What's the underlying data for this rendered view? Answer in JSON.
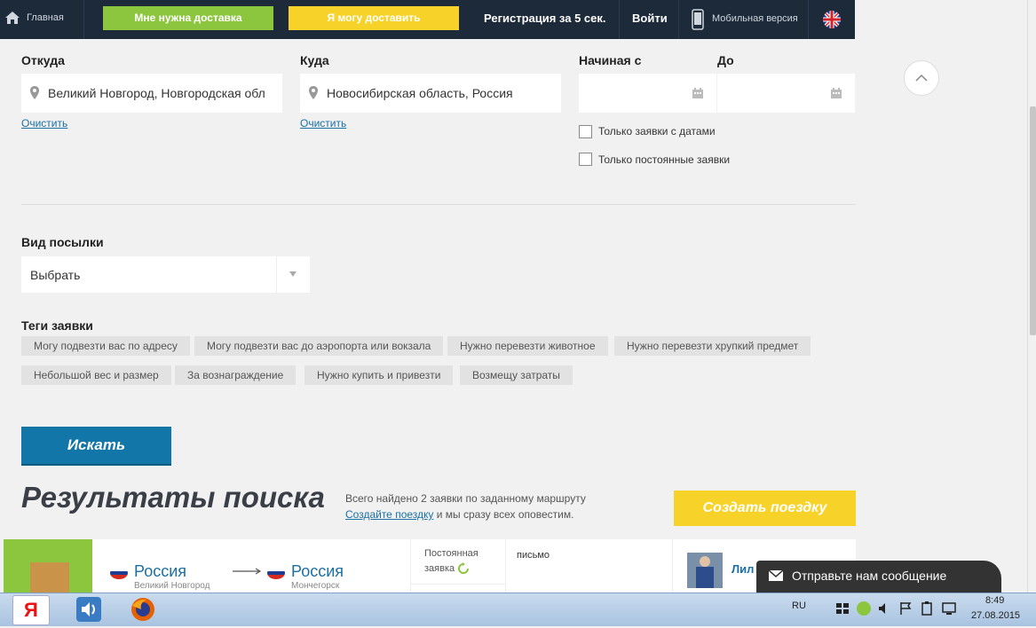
{
  "nav": {
    "home": "Главная",
    "need_delivery": "Мне нужна доставка",
    "can_deliver": "Я могу доставить",
    "register": "Регистрация за 5 сек.",
    "login": "Войти",
    "mobile": "Мобильная версия"
  },
  "form": {
    "from_label": "Откуда",
    "from_value": "Великий Новгород, Новгородская обл",
    "to_label": "Куда",
    "to_value": "Новосибирская область, Россия",
    "clear": "Очистить",
    "start_label": "Начиная с",
    "end_label": "До",
    "only_dates": "Только заявки с датами",
    "only_permanent": "Только постоянные заявки",
    "parcel_label": "Вид посылки",
    "parcel_value": "Выбрать",
    "tags_label": "Теги заявки",
    "tags": [
      "Могу подвезти вас по адресу",
      "Могу подвезти вас до аэропорта или вокзала",
      "Нужно перевезти животное",
      "Нужно перевезти хрупкий предмет",
      "Небольшой вес и размер",
      "За вознаграждение",
      "Нужно купить и привезти",
      "Возмещу затраты"
    ],
    "search_button": "Искать"
  },
  "results": {
    "title": "Результаты поиска",
    "found": "Всего найдено 2 заявки по заданному маршруту",
    "create_link": "Создайте поездку",
    "notify": " и мы сразу всех оповестим.",
    "create_button": "Создать поездку",
    "card": {
      "from_country": "Россия",
      "from_city": "Великий Новгород",
      "to_country": "Россия",
      "to_city": "Мончегорск",
      "type_line1": "Постоянная",
      "type_line2": "заявка",
      "item": "письмо",
      "user": "Лил"
    }
  },
  "chat": {
    "text": "Отправьте нам сообщение"
  },
  "taskbar": {
    "lang": "RU",
    "time": "8:49",
    "date": "27.08.2015"
  },
  "colors": {
    "nav_bg": "#1d2a3a",
    "green": "#8cc63e",
    "yellow": "#f7d32a",
    "blue": "#1277a8"
  }
}
